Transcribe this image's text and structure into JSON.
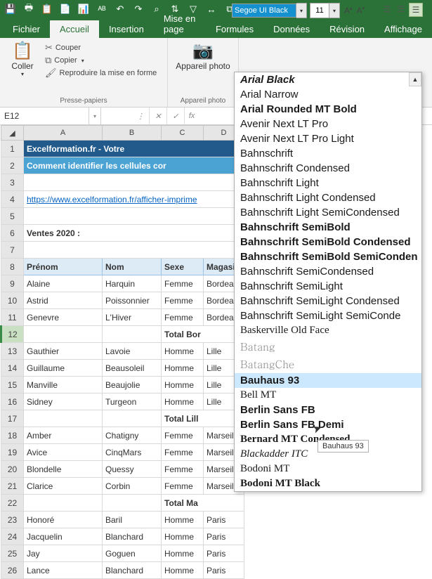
{
  "qat_icons": [
    "save-icon",
    "print-icon",
    "clipboard-icon",
    "paste-icon",
    "chart-icon",
    "spell-icon",
    "undo-icon",
    "redo-icon",
    "find-icon",
    "sort-icon",
    "filter-icon",
    "widen-icon",
    "group-icon",
    "translate-icon",
    "fill-icon",
    "lock-icon",
    "settings-icon",
    "more-icon"
  ],
  "tabs": [
    "Fichier",
    "Accueil",
    "Insertion",
    "Mise en page",
    "Formules",
    "Données",
    "Révision",
    "Affichage"
  ],
  "active_tab": "Accueil",
  "clipboard": {
    "paste": "Coller",
    "cut": "Couper",
    "copy": "Copier",
    "repro": "Reproduire la mise en forme",
    "label": "Presse-papiers"
  },
  "camera": {
    "btn": "Appareil photo",
    "label": "Appareil photo"
  },
  "font": {
    "name": "Segoe UI Black",
    "size": "11"
  },
  "namebox": "E12",
  "cols": [
    "A",
    "B",
    "C",
    "D"
  ],
  "rows": {
    "title": "Excelformation.fr - Votre",
    "subtitle": "Comment identifier les cellules cor",
    "link": "https://www.excelformation.fr/afficher-imprime",
    "ventes": "Ventes 2020 :",
    "hdr": [
      "Prénom",
      "Nom",
      "Sexe",
      "Magasin"
    ],
    "data": [
      {
        "n": "9",
        "c": [
          "Alaine",
          "Harquin",
          "Femme",
          "Bordeau"
        ]
      },
      {
        "n": "10",
        "c": [
          "Astrid",
          "Poissonnier",
          "Femme",
          "Bordeau"
        ]
      },
      {
        "n": "11",
        "c": [
          "Genevre",
          "L'Hiver",
          "Femme",
          "Bordeau"
        ]
      }
    ],
    "total1": "Total Bor",
    "data2": [
      {
        "n": "13",
        "c": [
          "Gauthier",
          "Lavoie",
          "Homme",
          "Lille"
        ]
      },
      {
        "n": "14",
        "c": [
          "Guillaume",
          "Beausoleil",
          "Homme",
          "Lille"
        ]
      },
      {
        "n": "15",
        "c": [
          "Manville",
          "Beaujolie",
          "Homme",
          "Lille"
        ]
      },
      {
        "n": "16",
        "c": [
          "Sidney",
          "Turgeon",
          "Homme",
          "Lille"
        ]
      }
    ],
    "total2": "Total Lill",
    "data3": [
      {
        "n": "18",
        "c": [
          "Amber",
          "Chatigny",
          "Femme",
          "Marseill"
        ]
      },
      {
        "n": "19",
        "c": [
          "Avice",
          "CinqMars",
          "Femme",
          "Marseill"
        ]
      },
      {
        "n": "20",
        "c": [
          "Blondelle",
          "Quessy",
          "Femme",
          "Marseill"
        ]
      },
      {
        "n": "21",
        "c": [
          "Clarice",
          "Corbin",
          "Femme",
          "Marseill"
        ]
      }
    ],
    "total3": "Total Ma",
    "data4": [
      {
        "n": "23",
        "c": [
          "Honoré",
          "Baril",
          "Homme",
          "Paris"
        ]
      },
      {
        "n": "24",
        "c": [
          "Jacquelin",
          "Blanchard",
          "Homme",
          "Paris"
        ]
      },
      {
        "n": "25",
        "c": [
          "Jay",
          "Goguen",
          "Homme",
          "Paris"
        ]
      },
      {
        "n": "26",
        "c": [
          "Lance",
          "Blanchard",
          "Homme",
          "Paris"
        ]
      }
    ]
  },
  "font_list": [
    {
      "t": "Arial Black",
      "s": "font-family:Arial;font-weight:900;font-style:italic"
    },
    {
      "t": "Arial Narrow",
      "s": "font-family:Arial;font-stretch:condensed"
    },
    {
      "t": "Arial Rounded MT Bold",
      "s": "font-family:Arial;font-weight:bold"
    },
    {
      "t": "Avenir Next LT Pro",
      "s": "font-family:Arial"
    },
    {
      "t": "Avenir Next LT Pro Light",
      "s": "font-family:Arial;font-weight:300"
    },
    {
      "t": "Bahnschrift",
      "s": "font-family:Bahnschrift,Arial"
    },
    {
      "t": "Bahnschrift Condensed",
      "s": "font-family:Bahnschrift,Arial;font-stretch:condensed"
    },
    {
      "t": "Bahnschrift Light",
      "s": "font-family:Bahnschrift,Arial;font-weight:300"
    },
    {
      "t": "Bahnschrift Light Condensed",
      "s": "font-family:Bahnschrift,Arial;font-weight:300;font-stretch:condensed"
    },
    {
      "t": "Bahnschrift Light SemiCondensed",
      "s": "font-family:Bahnschrift,Arial;font-weight:300"
    },
    {
      "t": "Bahnschrift SemiBold",
      "s": "font-family:Bahnschrift,Arial;font-weight:600"
    },
    {
      "t": "Bahnschrift SemiBold Condensed",
      "s": "font-family:Bahnschrift,Arial;font-weight:600;font-stretch:condensed"
    },
    {
      "t": "Bahnschrift SemiBold SemiConden",
      "s": "font-family:Bahnschrift,Arial;font-weight:600"
    },
    {
      "t": "Bahnschrift SemiCondensed",
      "s": "font-family:Bahnschrift,Arial"
    },
    {
      "t": "Bahnschrift SemiLight",
      "s": "font-family:Bahnschrift,Arial;font-weight:300"
    },
    {
      "t": "Bahnschrift SemiLight Condensed",
      "s": "font-family:Bahnschrift,Arial;font-weight:300;font-stretch:condensed"
    },
    {
      "t": "Bahnschrift SemiLight SemiConde",
      "s": "font-family:Bahnschrift,Arial;font-weight:300"
    },
    {
      "t": "Baskerville Old Face",
      "s": "font-family:Baskerville,serif"
    },
    {
      "t": "Batang",
      "s": "font-family:Batang,serif;color:#888"
    },
    {
      "t": "BatangChe",
      "s": "font-family:Batang,serif;color:#888"
    },
    {
      "t": "Bauhaus 93",
      "s": "font-family:Impact,sans-serif;font-weight:bold"
    },
    {
      "t": "Bell MT",
      "s": "font-family:serif"
    },
    {
      "t": "Berlin Sans FB",
      "s": "font-family:Arial;font-weight:bold"
    },
    {
      "t": "Berlin Sans FB Demi",
      "s": "font-family:Arial;font-weight:900"
    },
    {
      "t": "Bernard MT Condensed",
      "s": "font-family:serif;font-weight:bold;font-stretch:condensed"
    },
    {
      "t": "Blackadder ITC",
      "s": "font-family:cursive;font-style:italic"
    },
    {
      "t": "Bodoni MT",
      "s": "font-family:serif"
    },
    {
      "t": "Bodoni MT Black",
      "s": "font-family:serif;font-weight:900"
    }
  ],
  "highlighted_font": "Bauhaus 93",
  "tooltip": "Bauhaus 93"
}
